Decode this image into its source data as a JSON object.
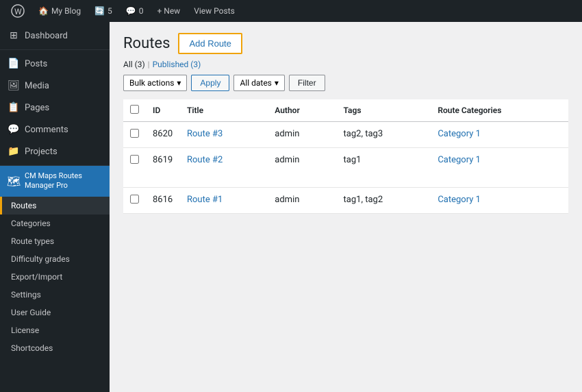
{
  "adminBar": {
    "site": "My Blog",
    "updates": "5",
    "comments": "0",
    "newLabel": "+ New",
    "viewPosts": "View Posts"
  },
  "sidebar": {
    "dashboard": "Dashboard",
    "posts": "Posts",
    "media": "Media",
    "pages": "Pages",
    "comments": "Comments",
    "projects": "Projects",
    "cmMaps": "CM Maps Routes Manager Pro",
    "routes": "Routes",
    "categories": "Categories",
    "routeTypes": "Route types",
    "difficultyGrades": "Difficulty grades",
    "exportImport": "Export/Import",
    "settings": "Settings",
    "userGuide": "User Guide",
    "license": "License",
    "shortcodes": "Shortcodes"
  },
  "page": {
    "title": "Routes",
    "addRouteLabel": "Add Route"
  },
  "filterTabs": {
    "all": "All (3)",
    "published": "Published (3)"
  },
  "filters": {
    "bulkActions": "Bulk actions",
    "apply": "Apply",
    "allDates": "All dates",
    "filter": "Filter"
  },
  "table": {
    "columns": [
      "",
      "ID",
      "Title",
      "Author",
      "Tags",
      "Route Categories"
    ],
    "rows": [
      {
        "id": "8620",
        "title": "Route #3",
        "author": "admin",
        "tags": "tag2, tag3",
        "category": "Category 1"
      },
      {
        "id": "8619",
        "title": "Route #2",
        "author": "admin",
        "tags": "tag1",
        "category": "Category 1"
      },
      {
        "id": "8616",
        "title": "Route #1",
        "author": "admin",
        "tags": "tag1, tag2",
        "category": "Category 1"
      }
    ]
  }
}
